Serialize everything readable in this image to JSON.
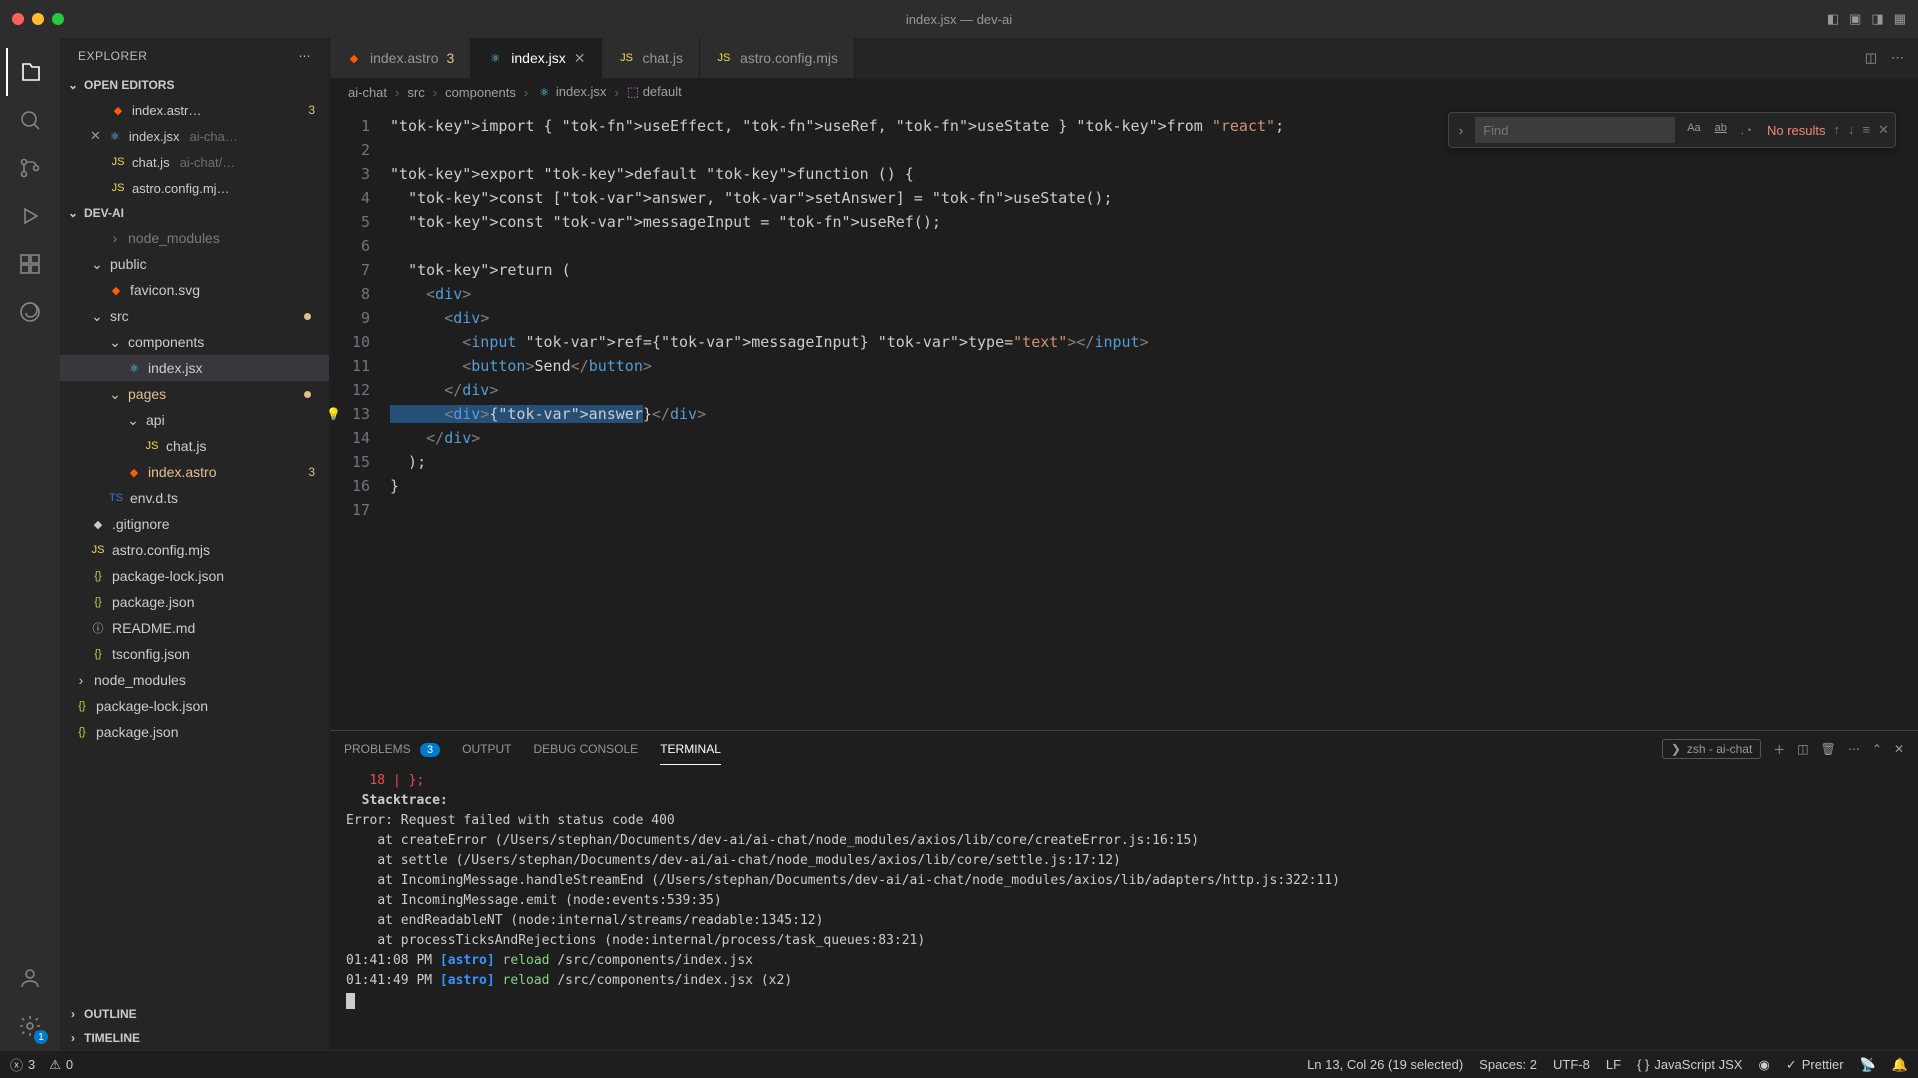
{
  "window": {
    "title": "index.jsx — dev-ai"
  },
  "sidebar": {
    "title": "EXPLORER",
    "sections": {
      "openEditors": "OPEN EDITORS",
      "project": "DEV-AI",
      "outline": "OUTLINE",
      "timeline": "TIMELINE"
    },
    "openEditors": [
      {
        "name": "index.astr…",
        "type": "astro",
        "badge": "3"
      },
      {
        "name": "index.jsx",
        "hint": "ai-cha…",
        "type": "react",
        "close": true
      },
      {
        "name": "chat.js",
        "hint": "ai-chat/…",
        "type": "js"
      },
      {
        "name": "astro.config.mj…",
        "type": "js"
      }
    ],
    "tree": [
      {
        "name": "node_modules",
        "kind": "folder-faded",
        "indent": 2
      },
      {
        "name": "public",
        "kind": "folder",
        "indent": 1,
        "open": true
      },
      {
        "name": "favicon.svg",
        "kind": "file",
        "indent": 2,
        "ic": "astro"
      },
      {
        "name": "src",
        "kind": "folder",
        "indent": 1,
        "open": true,
        "dot": true
      },
      {
        "name": "components",
        "kind": "folder",
        "indent": 2,
        "open": true
      },
      {
        "name": "index.jsx",
        "kind": "file",
        "indent": 3,
        "ic": "react",
        "active": true
      },
      {
        "name": "pages",
        "kind": "folder",
        "indent": 2,
        "open": true,
        "warn": true,
        "dot": true
      },
      {
        "name": "api",
        "kind": "folder",
        "indent": 3,
        "open": true
      },
      {
        "name": "chat.js",
        "kind": "file",
        "indent": 4,
        "ic": "js"
      },
      {
        "name": "index.astro",
        "kind": "file",
        "indent": 3,
        "ic": "astro",
        "warn": true,
        "badge": "3"
      },
      {
        "name": "env.d.ts",
        "kind": "file",
        "indent": 2,
        "ic": "ts"
      },
      {
        "name": ".gitignore",
        "kind": "file",
        "indent": 1,
        "ic": "file"
      },
      {
        "name": "astro.config.mjs",
        "kind": "file",
        "indent": 1,
        "ic": "js"
      },
      {
        "name": "package-lock.json",
        "kind": "file",
        "indent": 1,
        "ic": "json"
      },
      {
        "name": "package.json",
        "kind": "file",
        "indent": 1,
        "ic": "json"
      },
      {
        "name": "README.md",
        "kind": "file",
        "indent": 1,
        "ic": "md"
      },
      {
        "name": "tsconfig.json",
        "kind": "file",
        "indent": 1,
        "ic": "json"
      },
      {
        "name": "node_modules",
        "kind": "folder",
        "indent": 0
      },
      {
        "name": "package-lock.json",
        "kind": "file",
        "indent": 0,
        "ic": "json"
      },
      {
        "name": "package.json",
        "kind": "file",
        "indent": 0,
        "ic": "json"
      }
    ]
  },
  "tabs": [
    {
      "name": "index.astro",
      "ic": "astro",
      "badge": "3"
    },
    {
      "name": "index.jsx",
      "ic": "react",
      "active": true,
      "close": true
    },
    {
      "name": "chat.js",
      "ic": "js"
    },
    {
      "name": "astro.config.mjs",
      "ic": "js"
    }
  ],
  "breadcrumbs": [
    "ai-chat",
    "src",
    "components",
    "index.jsx",
    "default"
  ],
  "find": {
    "placeholder": "Find",
    "result": "No results"
  },
  "code": {
    "lines": [
      {
        "n": 1,
        "raw": "import { useEffect, useRef, useState } from \"react\";"
      },
      {
        "n": 2,
        "raw": ""
      },
      {
        "n": 3,
        "raw": "export default function () {"
      },
      {
        "n": 4,
        "raw": "  const [answer, setAnswer] = useState();"
      },
      {
        "n": 5,
        "raw": "  const messageInput = useRef();"
      },
      {
        "n": 6,
        "raw": ""
      },
      {
        "n": 7,
        "raw": "  return ("
      },
      {
        "n": 8,
        "raw": "    <div>"
      },
      {
        "n": 9,
        "raw": "      <div>"
      },
      {
        "n": 10,
        "raw": "        <input ref={messageInput} type=\"text\"></input>"
      },
      {
        "n": 11,
        "raw": "        <button>Send</button>"
      },
      {
        "n": 12,
        "raw": "      </div>"
      },
      {
        "n": 13,
        "raw": "      <div>{answer}</div>",
        "bulb": true,
        "selected": true
      },
      {
        "n": 14,
        "raw": "    </div>"
      },
      {
        "n": 15,
        "raw": "  );"
      },
      {
        "n": 16,
        "raw": "}"
      },
      {
        "n": 17,
        "raw": ""
      }
    ]
  },
  "panel": {
    "tabs": {
      "problems": "PROBLEMS",
      "problemsCount": "3",
      "output": "OUTPUT",
      "debug": "DEBUG CONSOLE",
      "terminal": "TERMINAL"
    },
    "termLabel": "zsh - ai-chat",
    "terminal": [
      {
        "cls": "term-red",
        "text": "   18 | };"
      },
      {
        "cls": "term-bold",
        "text": "  Stacktrace:"
      },
      {
        "cls": "",
        "text": "Error: Request failed with status code 400"
      },
      {
        "cls": "",
        "text": "    at createError (/Users/stephan/Documents/dev-ai/ai-chat/node_modules/axios/lib/core/createError.js:16:15)"
      },
      {
        "cls": "",
        "text": "    at settle (/Users/stephan/Documents/dev-ai/ai-chat/node_modules/axios/lib/core/settle.js:17:12)"
      },
      {
        "cls": "",
        "text": "    at IncomingMessage.handleStreamEnd (/Users/stephan/Documents/dev-ai/ai-chat/node_modules/axios/lib/adapters/http.js:322:11)"
      },
      {
        "cls": "",
        "text": "    at IncomingMessage.emit (node:events:539:35)"
      },
      {
        "cls": "",
        "text": "    at endReadableNT (node:internal/streams/readable:1345:12)"
      },
      {
        "cls": "",
        "text": "    at processTicksAndRejections (node:internal/process/task_queues:83:21)"
      },
      {
        "cls": "",
        "text": ""
      },
      {
        "cls": "reload",
        "ts": "01:41:08 PM",
        "tag": "[astro]",
        "act": "reload",
        "path": "/src/components/index.jsx"
      },
      {
        "cls": "reload",
        "ts": "01:41:49 PM",
        "tag": "[astro]",
        "act": "reload",
        "path": "/src/components/index.jsx (x2)"
      }
    ]
  },
  "status": {
    "errors": "3",
    "warnings": "0",
    "selection": "Ln 13, Col 26 (19 selected)",
    "spaces": "Spaces: 2",
    "encoding": "UTF-8",
    "eol": "LF",
    "lang": "JavaScript JSX",
    "prettier": "Prettier"
  }
}
